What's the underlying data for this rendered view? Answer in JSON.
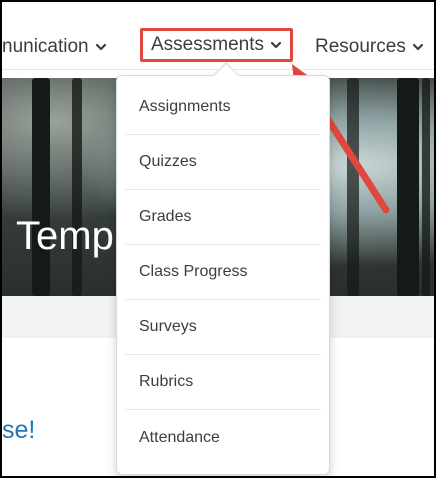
{
  "nav": {
    "items": [
      {
        "label": "nunication"
      },
      {
        "label": "Assessments"
      },
      {
        "label": "Resources"
      }
    ]
  },
  "banner": {
    "title": "Temp"
  },
  "content": {
    "welcome_fragment": "se!"
  },
  "dropdown": {
    "items": [
      {
        "label": "Assignments"
      },
      {
        "label": "Quizzes"
      },
      {
        "label": "Grades"
      },
      {
        "label": "Class Progress"
      },
      {
        "label": "Surveys"
      },
      {
        "label": "Rubrics"
      },
      {
        "label": "Attendance"
      }
    ]
  },
  "colors": {
    "highlight": "#e0483e",
    "link": "#1f77b4",
    "text": "#3a3d42"
  },
  "icons": {
    "nav_chevron": "chevron-down-icon",
    "annotation": "arrow-icon"
  }
}
